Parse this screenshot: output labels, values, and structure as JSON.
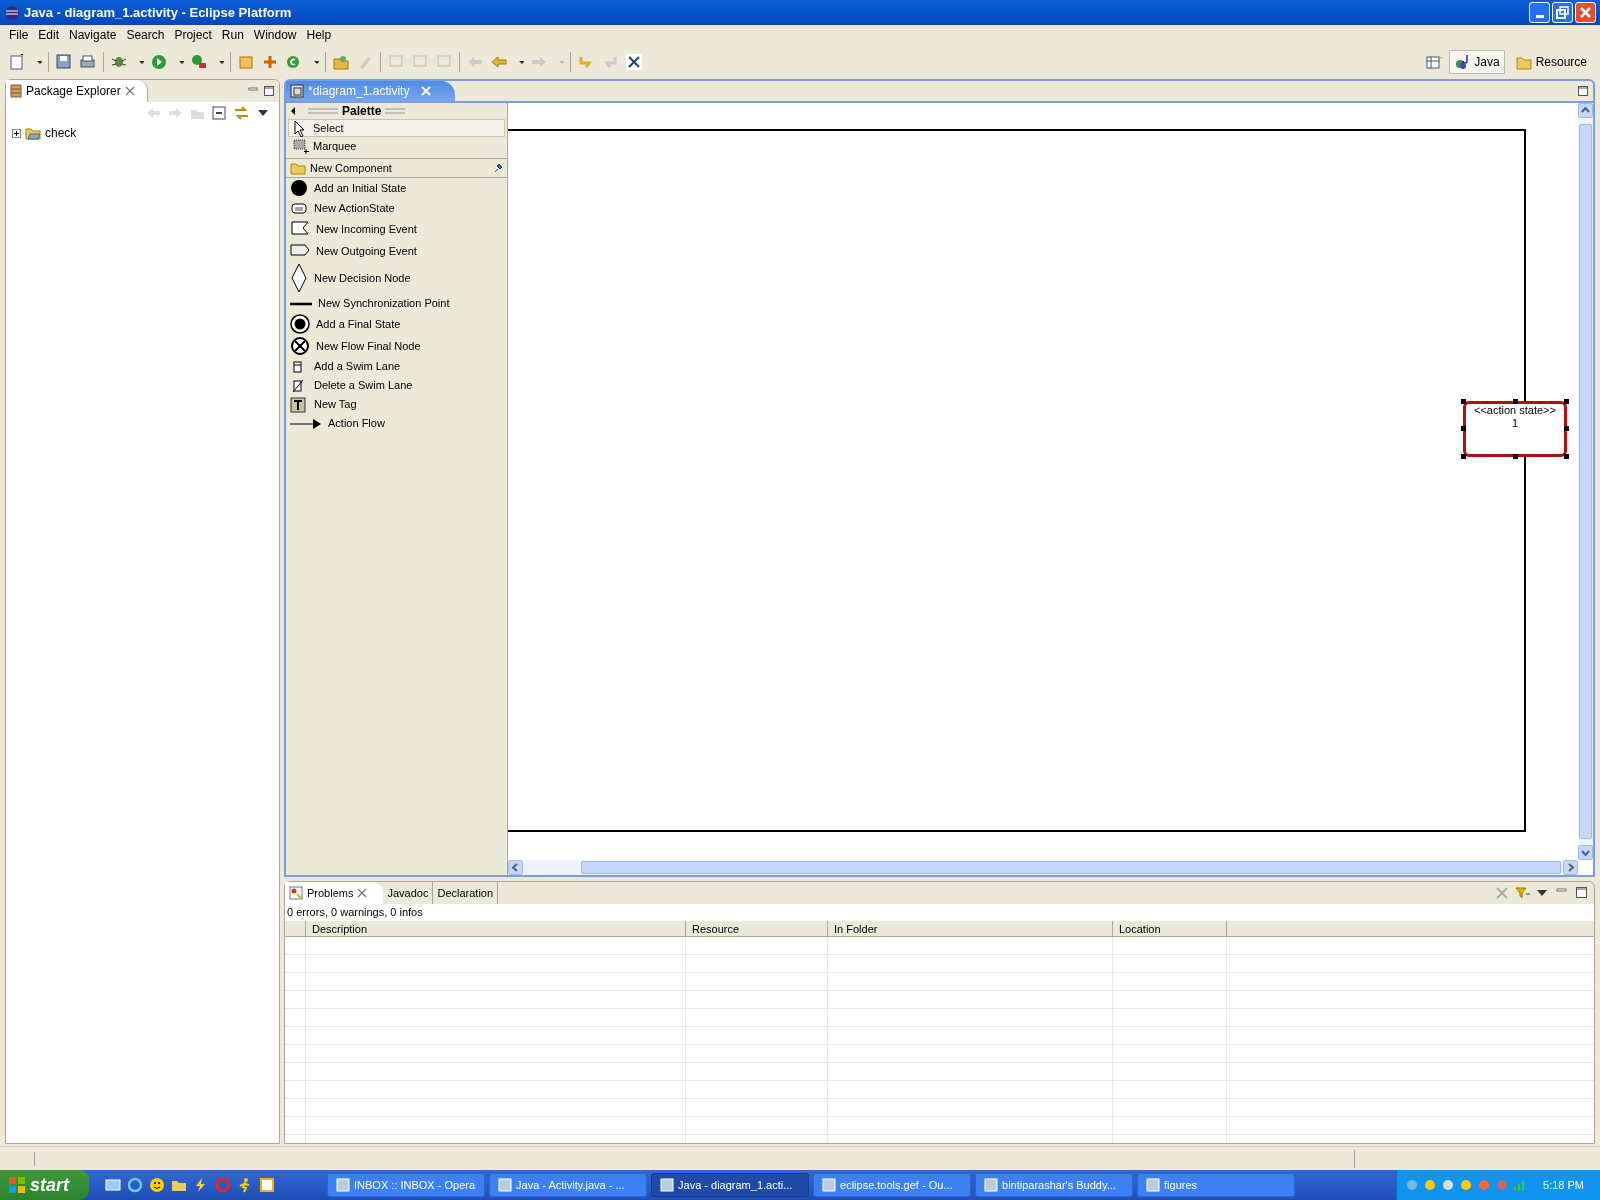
{
  "window": {
    "title": "Java - diagram_1.activity - Eclipse Platform"
  },
  "menu": [
    "File",
    "Edit",
    "Navigate",
    "Search",
    "Project",
    "Run",
    "Window",
    "Help"
  ],
  "perspectives": [
    {
      "label": "Java",
      "selected": true
    },
    {
      "label": "Resource",
      "selected": false
    }
  ],
  "package_explorer": {
    "title": "Package Explorer",
    "tree": [
      {
        "label": "check",
        "expanded": false
      }
    ]
  },
  "editor": {
    "tab": {
      "label": "*diagram_1.activity"
    },
    "palette": {
      "title": "Palette",
      "tools": [
        {
          "label": "Select",
          "kind": "select",
          "selected": true
        },
        {
          "label": "Marquee",
          "kind": "marquee",
          "selected": false
        }
      ],
      "drawer": {
        "label": "New Component",
        "items": [
          {
            "label": "Add an Initial State",
            "kind": "initial"
          },
          {
            "label": "New ActionState",
            "kind": "action"
          },
          {
            "label": "New Incoming Event",
            "kind": "incoming"
          },
          {
            "label": "New Outgoing Event",
            "kind": "outgoing"
          },
          {
            "label": "New Decision Node",
            "kind": "decision"
          },
          {
            "label": "New Synchronization Point",
            "kind": "sync"
          },
          {
            "label": "Add a Final State",
            "kind": "final"
          },
          {
            "label": "New Flow Final Node",
            "kind": "flowfinal"
          },
          {
            "label": "Add a Swim Lane",
            "kind": "addlane"
          },
          {
            "label": "Delete a Swim Lane",
            "kind": "deletelane"
          },
          {
            "label": "New Tag",
            "kind": "tag"
          },
          {
            "label": "Action Flow",
            "kind": "flow"
          }
        ]
      }
    },
    "diagram": {
      "nodes": [
        {
          "stereotype": "<<action state>>",
          "name": "1",
          "selected": true
        }
      ]
    }
  },
  "problems": {
    "tabs": [
      {
        "label": "Problems",
        "selected": true
      },
      {
        "label": "Javadoc",
        "selected": false
      },
      {
        "label": "Declaration",
        "selected": false
      }
    ],
    "summary": "0 errors, 0 warnings, 0 infos",
    "columns": [
      "Description",
      "Resource",
      "In Folder",
      "Location"
    ]
  },
  "taskbar": {
    "start": "start",
    "tasks": [
      {
        "label": "INBOX :: INBOX - Opera",
        "selected": false
      },
      {
        "label": "Java - Activity.java - ...",
        "selected": false
      },
      {
        "label": "Java - diagram_1.acti...",
        "selected": true
      },
      {
        "label": "eclipse.tools.gef - Ou...",
        "selected": false
      },
      {
        "label": "bintiparashar's Buddy...",
        "selected": false
      },
      {
        "label": "figures",
        "selected": false
      }
    ],
    "clock": "5:18 PM"
  }
}
